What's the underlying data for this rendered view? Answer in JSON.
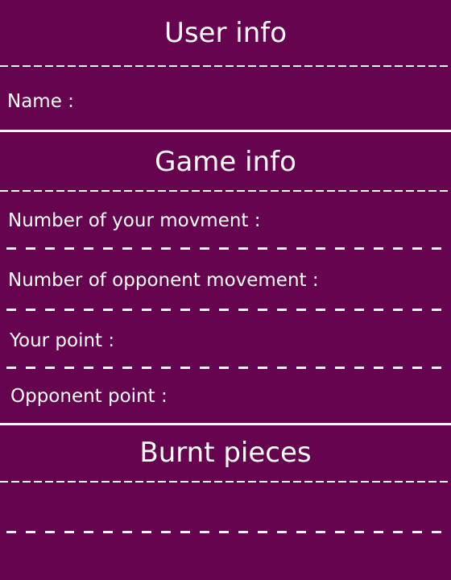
{
  "colors": {
    "background": "#660450",
    "text": "#ffffff"
  },
  "user_info": {
    "title": "User info",
    "name_label": "Name :"
  },
  "game_info": {
    "title": "Game info",
    "your_movement_label": "Number of your movment :",
    "opponent_movement_label": "Number of opponent movement :",
    "your_point_label": "Your point :",
    "opponent_point_label": "Opponent point :"
  },
  "burnt_pieces": {
    "title": "Burnt pieces"
  }
}
